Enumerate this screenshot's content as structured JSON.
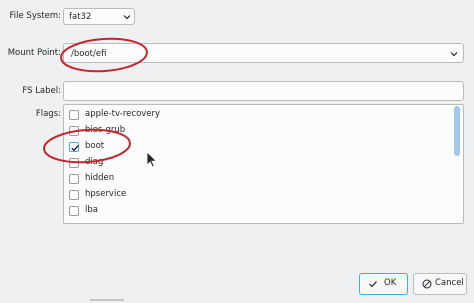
{
  "form": {
    "file_system_label": "File System:",
    "file_system_value": "fat32",
    "mount_point_label": "Mount Point:",
    "mount_point_value": "/boot/efi",
    "fs_label_label": "FS Label:",
    "fs_label_value": "",
    "flags_label": "Flags:"
  },
  "flags": [
    {
      "label": "apple-tv-recovery",
      "checked": false
    },
    {
      "label": "bios-grub",
      "checked": false
    },
    {
      "label": "boot",
      "checked": true
    },
    {
      "label": "diag",
      "checked": false
    },
    {
      "label": "hidden",
      "checked": false
    },
    {
      "label": "hpservice",
      "checked": false
    },
    {
      "label": "lba",
      "checked": false
    }
  ],
  "buttons": {
    "ok_label": "OK",
    "cancel_label": "Cancel"
  },
  "icons": {
    "combo_arrow": "chevron-down-icon",
    "check": "check-icon",
    "ok": "checkmark-icon",
    "cancel": "cancel-icon",
    "cursor": "mouse-pointer-icon"
  },
  "colors": {
    "accent": "#3daee9",
    "annotation": "#c0282d"
  }
}
